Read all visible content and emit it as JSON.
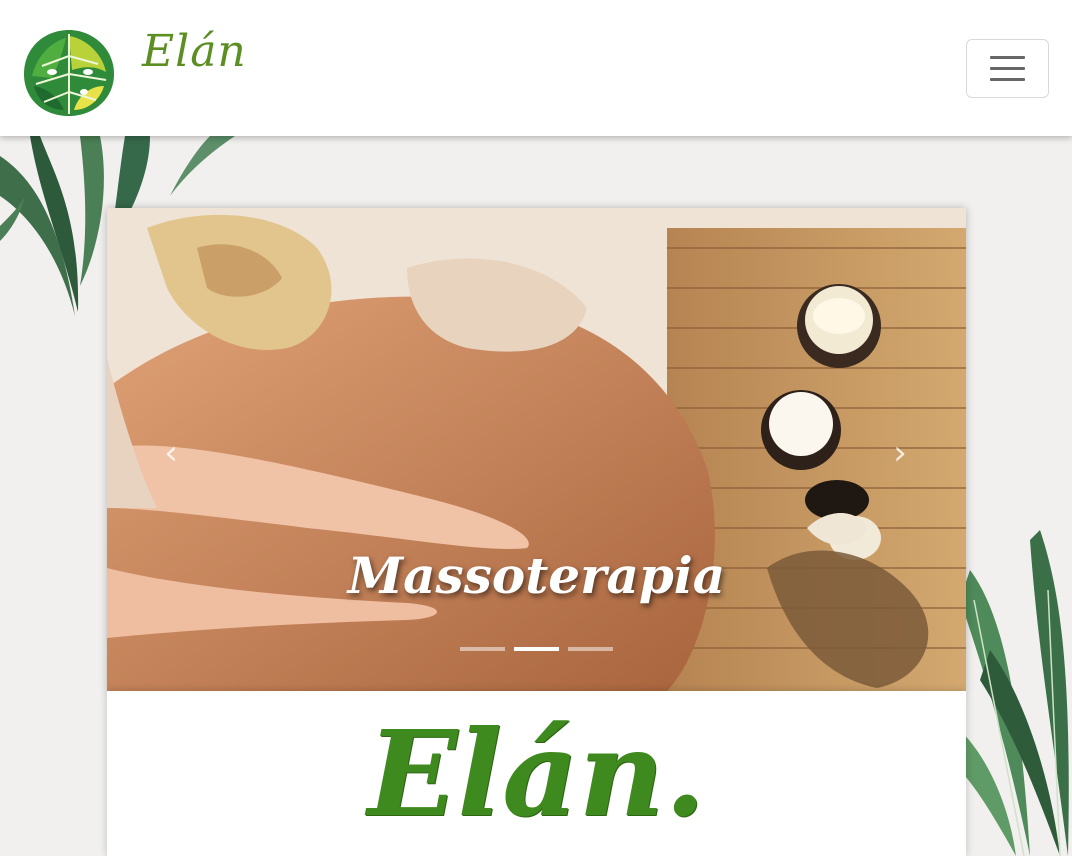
{
  "navbar": {
    "brand_name": "Elán",
    "logo_icon": "monstera-leaf-icon",
    "toggler_icon": "hamburger-menu-icon"
  },
  "carousel": {
    "active_slide_caption": "Massoterapia",
    "prev_label": "Previous",
    "next_label": "Next",
    "prev_glyph": "‹",
    "next_glyph": "›",
    "indicator_count": 3,
    "active_indicator": 1
  },
  "content": {
    "logo_text": "Elán."
  },
  "colors": {
    "brand_green": "#5c8f22",
    "logo_green": "#3f8a1e",
    "page_background": "#f1f0ee"
  }
}
